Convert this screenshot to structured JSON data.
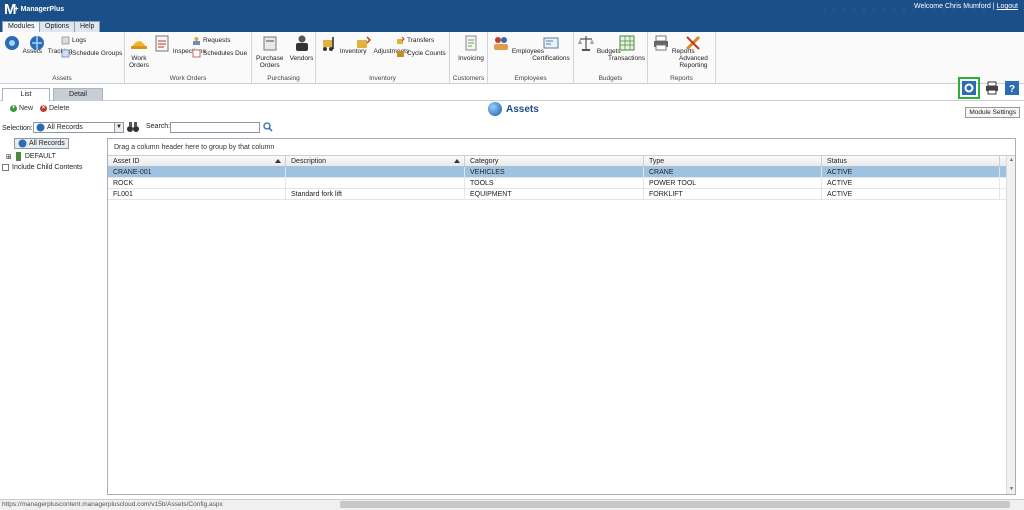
{
  "brand": {
    "letter": "M",
    "name": "ManagerPlus"
  },
  "welcome": {
    "text": "Welcome Chris Mumford |",
    "logout": "Logout"
  },
  "ribbon_tabs": [
    "Modules",
    "Options",
    "Help"
  ],
  "ribbon": {
    "assets": {
      "group": "Assets",
      "assets": "Assets",
      "tracking": "Tracking",
      "logs": "Logs",
      "schedule_groups": "Schedule Groups"
    },
    "work_orders": {
      "group": "Work Orders",
      "work_orders_l1": "Work",
      "work_orders_l2": "Orders",
      "inspections": "Inspections",
      "requests": "Requests",
      "schedules_due": "Schedules Due"
    },
    "purchasing": {
      "group": "Purchasing",
      "po_l1": "Purchase",
      "po_l2": "Orders",
      "vendors": "Vendors"
    },
    "inventory": {
      "group": "Inventory",
      "inventory": "Inventory",
      "adjustments": "Adjustments",
      "transfers": "Transfers",
      "cycle_counts": "Cycle Counts"
    },
    "customers": {
      "group": "Customers",
      "invoicing": "Invoicing"
    },
    "employees": {
      "group": "Employees",
      "employees": "Employees",
      "certifications": "Certifications"
    },
    "budgets": {
      "group": "Budgets",
      "budgets": "Budgets",
      "transactions": "Transactions"
    },
    "reports": {
      "group": "Reports",
      "reports": "Reports",
      "adv_l1": "Advanced",
      "adv_l2": "Reporting"
    }
  },
  "subtabs": {
    "list": "List",
    "detail": "Detail"
  },
  "tooltip": "Module Settings",
  "actions": {
    "new": "New",
    "delete": "Delete"
  },
  "page_title": "Assets",
  "selection": {
    "label": "Selection:",
    "value": "All Records",
    "search_label": "Search:",
    "search_value": ""
  },
  "tree": {
    "all_records": "All Records",
    "default": "DEFAULT",
    "include_child": "Include Child Contents"
  },
  "grid": {
    "group_hint": "Drag a column header here to group by that column",
    "columns": [
      "Asset ID",
      "Description",
      "Category",
      "Type",
      "Status"
    ],
    "rows": [
      [
        "CRANE-001",
        "",
        "VEHICLES",
        "CRANE",
        "ACTIVE"
      ],
      [
        "ROCK",
        "",
        "TOOLS",
        "POWER TOOL",
        "ACTIVE"
      ],
      [
        "FL001",
        "Standard fork lift",
        "EQUIPMENT",
        "FORKLIFT",
        "ACTIVE"
      ]
    ]
  },
  "status_url": "https://managerpluscontent.managerpluscloud.com/v15b/Assets/Config.aspx",
  "colors": {
    "topbar": "#1b4f8a",
    "selected_row": "#9ec3e2",
    "highlight": "#2fae3c"
  }
}
